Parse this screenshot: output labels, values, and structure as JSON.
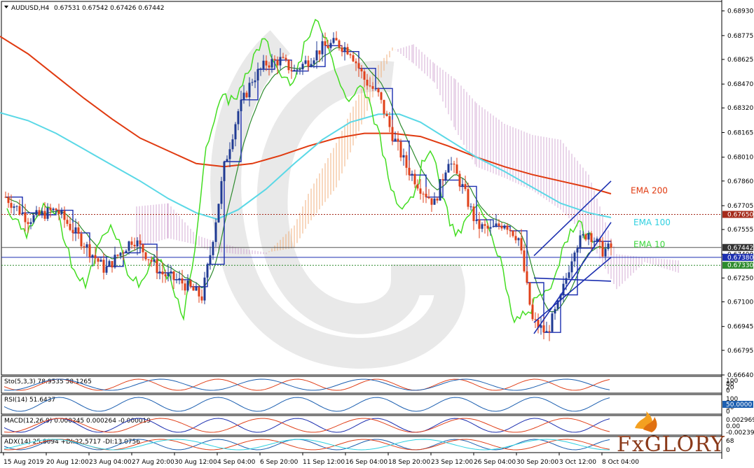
{
  "header": {
    "symbol": "AUDUSD,H4",
    "ohlc": "0.67531 0.67542 0.67426 0.67442"
  },
  "chart_data": {
    "type": "candlestick",
    "symbol": "AUDUSD",
    "timeframe": "H4",
    "ylim": [
      0.6664,
      0.6899
    ],
    "y_ticks": [
      "0.68930",
      "0.68775",
      "0.68625",
      "0.68470",
      "0.68320",
      "0.68165",
      "0.68010",
      "0.67860",
      "0.67705",
      "0.67555",
      "0.67400",
      "0.67250",
      "0.67100",
      "0.66945",
      "0.66795",
      "0.66640"
    ],
    "x_ticks": [
      "15 Aug 2019",
      "20 Aug 12:00",
      "23 Aug 04:00",
      "27 Aug 20:00",
      "30 Aug 12:00",
      "4 Sep 04:00",
      "6 Sep 20:00",
      "11 Sep 12:00",
      "16 Sep 04:00",
      "18 Sep 20:00",
      "23 Sep 12:00",
      "26 Sep 04:00",
      "30 Sep 20:00",
      "3 Oct 12:00",
      "8 Oct 04:00"
    ],
    "price_tags": [
      {
        "value": 0.6765,
        "text": "0.67650",
        "color": "#a52a1a"
      },
      {
        "value": 0.67442,
        "text": "0.67442",
        "color": "#333333"
      },
      {
        "value": 0.6738,
        "text": "0.67380",
        "color": "#1c2fb0"
      },
      {
        "value": 0.6733,
        "text": "0.67330",
        "color": "#2e8b2e"
      }
    ],
    "hlines": [
      {
        "value": 0.6765,
        "style": "dotted",
        "color": "#a52a1a"
      },
      {
        "value": 0.67442,
        "style": "solid",
        "color": "#555555"
      },
      {
        "value": 0.6738,
        "style": "solid",
        "color": "#1c2fb0"
      },
      {
        "value": 0.6733,
        "style": "dotted",
        "color": "#2e8b2e"
      }
    ],
    "series": [
      {
        "name": "EMA 200",
        "color": "#e03a10",
        "points": [
          [
            0,
            0.6877
          ],
          [
            40,
            0.6866
          ],
          [
            80,
            0.6852
          ],
          [
            120,
            0.6838
          ],
          [
            160,
            0.6825
          ],
          [
            200,
            0.6813
          ],
          [
            240,
            0.6805
          ],
          [
            280,
            0.6797
          ],
          [
            320,
            0.6795
          ],
          [
            360,
            0.6797
          ],
          [
            400,
            0.6802
          ],
          [
            440,
            0.6808
          ],
          [
            480,
            0.6813
          ],
          [
            520,
            0.6816
          ],
          [
            560,
            0.6816
          ],
          [
            600,
            0.6814
          ],
          [
            640,
            0.6808
          ],
          [
            680,
            0.6801
          ],
          [
            720,
            0.6795
          ],
          [
            760,
            0.679
          ],
          [
            800,
            0.6786
          ],
          [
            840,
            0.6782
          ],
          [
            872,
            0.6778
          ]
        ]
      },
      {
        "name": "EMA 100",
        "color": "#5ad8e6",
        "points": [
          [
            0,
            0.6829
          ],
          [
            40,
            0.6824
          ],
          [
            80,
            0.6816
          ],
          [
            120,
            0.6806
          ],
          [
            160,
            0.6796
          ],
          [
            200,
            0.6786
          ],
          [
            240,
            0.6775
          ],
          [
            280,
            0.6766
          ],
          [
            310,
            0.6762
          ],
          [
            340,
            0.6768
          ],
          [
            380,
            0.6781
          ],
          [
            420,
            0.6797
          ],
          [
            460,
            0.6812
          ],
          [
            500,
            0.6823
          ],
          [
            540,
            0.6828
          ],
          [
            570,
            0.6828
          ],
          [
            600,
            0.6823
          ],
          [
            640,
            0.6812
          ],
          [
            680,
            0.6801
          ],
          [
            720,
            0.6792
          ],
          [
            760,
            0.6782
          ],
          [
            800,
            0.6772
          ],
          [
            840,
            0.6766
          ],
          [
            872,
            0.6763
          ]
        ]
      }
    ],
    "ema_labels": [
      {
        "name": "EMA 200",
        "color": "#e03a10"
      },
      {
        "name": "EMA 100",
        "color": "#2fd0e0"
      },
      {
        "name": "EMA 10",
        "color": "#3bd63b"
      }
    ],
    "indicators": [
      {
        "label": "Sto(5,3,3) 78.9535 58.1265",
        "ticks": [
          "100",
          "80",
          "20",
          "0"
        ]
      },
      {
        "label": "RSI(14) 51.6437",
        "ticks": [
          "100",
          "70",
          "30",
          "0"
        ],
        "tag": "50.0000"
      },
      {
        "label": "MACD(12,26,9) 0.000245 0.000264 -0.000019",
        "ticks": [
          "0.002969",
          "0.00",
          "-0.002398"
        ]
      },
      {
        "label": "ADX(14) 25.8094 +DI:22.5717 -DI:13.0756",
        "ticks": [
          "68",
          "0"
        ]
      }
    ]
  },
  "branding": {
    "logo_text": "FxGLORY"
  }
}
